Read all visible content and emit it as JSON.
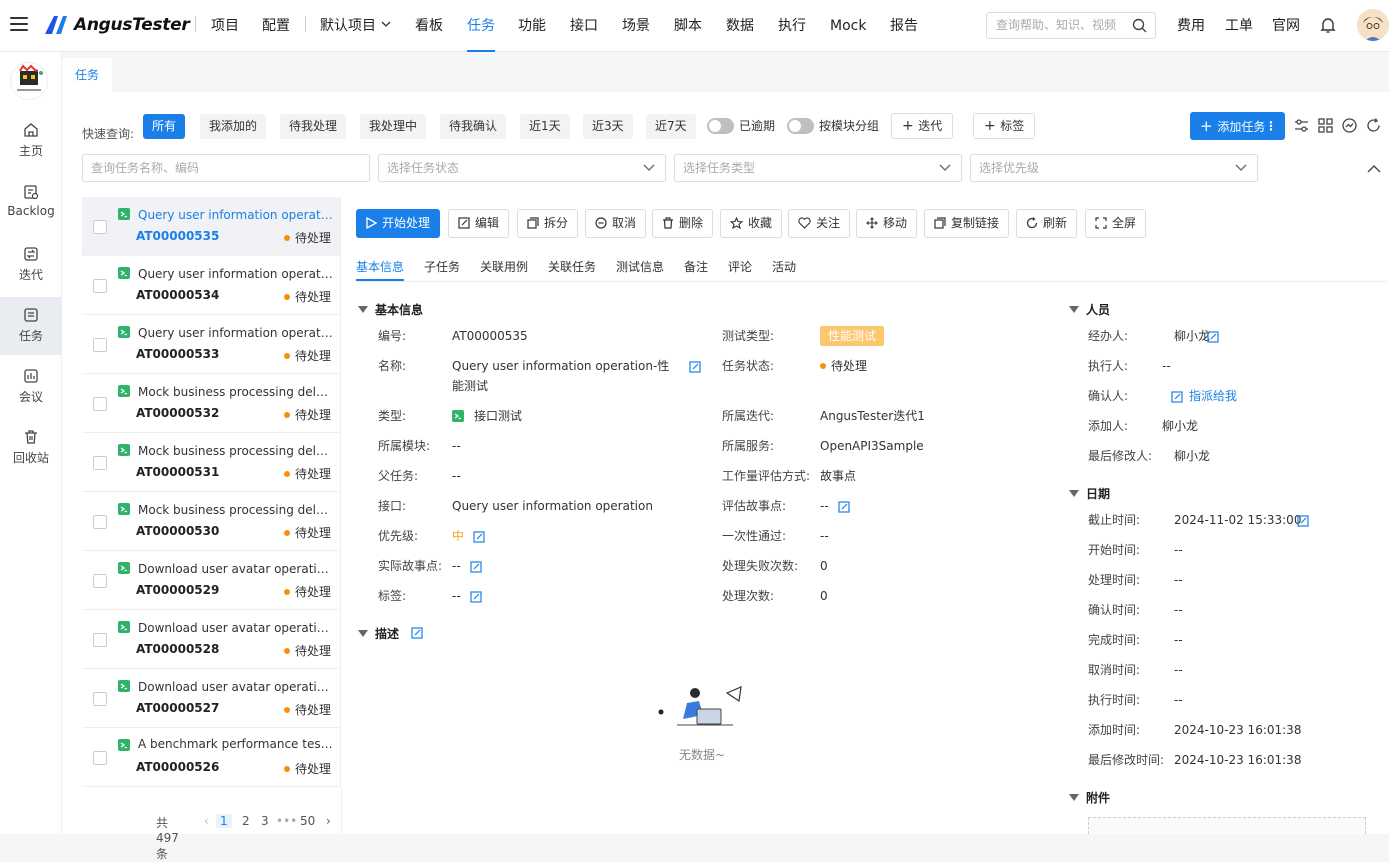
{
  "app": {
    "brand": "AngusTester"
  },
  "header": {
    "nav": [
      "项目",
      "配置",
      "默认项目",
      "看板",
      "任务",
      "功能",
      "接口",
      "场景",
      "脚本",
      "数据",
      "执行",
      "Mock",
      "报告"
    ],
    "active_nav": "任务",
    "search_placeholder": "查询帮助、知识、视频",
    "right_links": [
      "费用",
      "工单",
      "官网"
    ]
  },
  "sidebar": {
    "items": [
      {
        "label": "主页",
        "icon": "home-icon"
      },
      {
        "label": "Backlog",
        "icon": "backlog-icon"
      },
      {
        "label": "迭代",
        "icon": "sprint-icon"
      },
      {
        "label": "任务",
        "icon": "task-icon"
      },
      {
        "label": "会议",
        "icon": "meeting-icon"
      },
      {
        "label": "回收站",
        "icon": "trash-icon"
      }
    ],
    "active": "任务"
  },
  "page_tab": "任务",
  "quick": {
    "label": "快速查询:",
    "chips": [
      "所有",
      "我添加的",
      "待我处理",
      "我处理中",
      "待我确认",
      "近1天",
      "近3天",
      "近7天"
    ],
    "active": "所有",
    "toggle_overdue": "已逾期",
    "toggle_group": "按模块分组",
    "add_sprint": "迭代",
    "add_tag": "标签",
    "add_task": "添加任务"
  },
  "filters": {
    "name_placeholder": "查询任务名称、编码",
    "status_placeholder": "选择任务状态",
    "type_placeholder": "选择任务类型",
    "priority_placeholder": "选择优先级"
  },
  "tasks": [
    {
      "name": "Query user information operation-性能测试",
      "code": "AT00000535",
      "status": "待处理"
    },
    {
      "name": "Query user information operation-功能测试",
      "code": "AT00000534",
      "status": "待处理"
    },
    {
      "name": "Query user information operation-稳定性测试",
      "code": "AT00000533",
      "status": "待处理"
    },
    {
      "name": "Mock business processing delay operation-性能测试",
      "code": "AT00000532",
      "status": "待处理"
    },
    {
      "name": "Mock business processing delay operation-功能测试",
      "code": "AT00000531",
      "status": "待处理"
    },
    {
      "name": "Mock business processing delay operation-稳定性测试",
      "code": "AT00000530",
      "status": "待处理"
    },
    {
      "name": "Download user avatar operation-性能测试",
      "code": "AT00000529",
      "status": "待处理"
    },
    {
      "name": "Download user avatar operation-功能测试",
      "code": "AT00000528",
      "status": "待处理"
    },
    {
      "name": "Download user avatar operation-稳定性测试",
      "code": "AT00000527",
      "status": "待处理"
    },
    {
      "name": "A benchmark performance testing task",
      "code": "AT00000526",
      "status": "待处理"
    }
  ],
  "pagination": {
    "total": "共497条",
    "pages": [
      "1",
      "2",
      "3",
      "•••",
      "50"
    ],
    "current": "1"
  },
  "actions": [
    "开始处理",
    "编辑",
    "拆分",
    "取消",
    "删除",
    "收藏",
    "关注",
    "移动",
    "复制链接",
    "刷新",
    "全屏"
  ],
  "detail_tabs": [
    "基本信息",
    "子任务",
    "关联用例",
    "关联任务",
    "测试信息",
    "备注",
    "评论",
    "活动"
  ],
  "basic": {
    "title": "基本信息",
    "left": [
      {
        "label": "编号:",
        "value": "AT00000535"
      },
      {
        "label": "名称:",
        "value": "Query user information operation-性能测试"
      },
      {
        "label": "类型:",
        "value": "接口测试"
      },
      {
        "label": "所属模块:",
        "value": "--"
      },
      {
        "label": "父任务:",
        "value": "--"
      },
      {
        "label": "接口:",
        "value": "Query user information operation"
      },
      {
        "label": "优先级:",
        "value": "中"
      },
      {
        "label": "实际故事点:",
        "value": "--"
      },
      {
        "label": "标签:",
        "value": "--"
      }
    ],
    "right": [
      {
        "label": "测试类型:",
        "value": "性能测试"
      },
      {
        "label": "任务状态:",
        "value": "待处理"
      },
      {
        "label": "所属迭代:",
        "value": "AngusTester迭代1"
      },
      {
        "label": "所属服务:",
        "value": "OpenAPI3Sample"
      },
      {
        "label": "工作量评估方式:",
        "value": "故事点"
      },
      {
        "label": "评估故事点:",
        "value": "--"
      },
      {
        "label": "一次性通过:",
        "value": "--"
      },
      {
        "label": "处理失败次数:",
        "value": "0"
      },
      {
        "label": "处理次数:",
        "value": "0"
      }
    ]
  },
  "description": {
    "title": "描述",
    "empty": "无数据~"
  },
  "people": {
    "title": "人员",
    "rows": [
      {
        "label": "经办人:",
        "value": "柳小龙"
      },
      {
        "label": "执行人:",
        "value": "--"
      },
      {
        "label": "确认人:",
        "value": "指派给我"
      },
      {
        "label": "添加人:",
        "value": "柳小龙"
      },
      {
        "label": "最后修改人:",
        "value": "柳小龙"
      }
    ]
  },
  "dates": {
    "title": "日期",
    "rows": [
      {
        "label": "截止时间:",
        "value": "2024-11-02 15:33:00"
      },
      {
        "label": "开始时间:",
        "value": "--"
      },
      {
        "label": "处理时间:",
        "value": "--"
      },
      {
        "label": "确认时间:",
        "value": "--"
      },
      {
        "label": "完成时间:",
        "value": "--"
      },
      {
        "label": "取消时间:",
        "value": "--"
      },
      {
        "label": "执行时间:",
        "value": "--"
      },
      {
        "label": "添加时间:",
        "value": "2024-10-23 16:01:38"
      },
      {
        "label": "最后修改时间:",
        "value": "2024-10-23 16:01:38"
      }
    ]
  },
  "attachments": {
    "title": "附件"
  },
  "colors": {
    "primary": "#1a7fe8",
    "pending": "#f79009",
    "test_tag": "#fbc870",
    "priority_mid": "#f5a623"
  }
}
